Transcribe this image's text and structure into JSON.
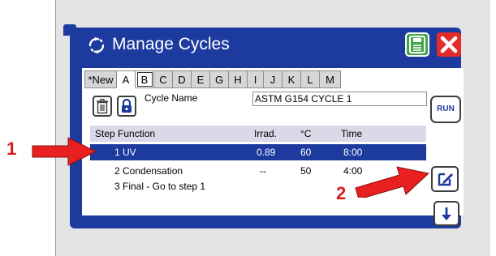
{
  "window": {
    "title": "Manage Cycles"
  },
  "tabs": [
    "*New",
    "A",
    "B",
    "C",
    "D",
    "E",
    "G",
    "H",
    "I",
    "J",
    "K",
    "L",
    "M"
  ],
  "active_tab": "A",
  "cycle": {
    "name_label": "Cycle Name",
    "name_value": "ASTM G154 CYCLE 1"
  },
  "buttons": {
    "run_label": "RUN"
  },
  "table": {
    "headers": {
      "step_function": "Step  Function",
      "irrad": "Irrad.",
      "temp": "°C",
      "time": "Time"
    },
    "rows": [
      {
        "label": "1 UV",
        "irrad": "0.89",
        "temp": "60",
        "time": "8:00",
        "selected": true
      },
      {
        "label": "2 Condensation",
        "irrad": "--",
        "temp": "50",
        "time": "4:00",
        "selected": false
      },
      {
        "label": "3 Final - Go to step 1",
        "irrad": "",
        "temp": "",
        "time": "",
        "selected": false
      }
    ]
  },
  "annotations": {
    "callout_1": "1",
    "callout_2": "2"
  },
  "colors": {
    "window_blue": "#1d3a9e",
    "save_green": "#3fa64a",
    "close_red": "#e52a2a",
    "arrow_red": "#e8201f",
    "device_gray": "#e4e4e4",
    "header_gray": "#d9d9e8"
  },
  "icons": [
    "refresh-cycle-icon",
    "save-floppy-icon",
    "close-x-icon",
    "trash-icon",
    "lock-icon",
    "edit-pencil-icon",
    "arrow-down-icon",
    "red-arrow-icon"
  ]
}
